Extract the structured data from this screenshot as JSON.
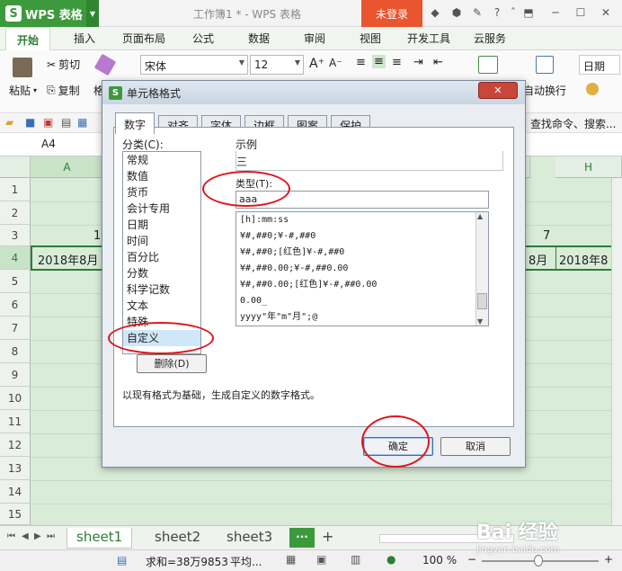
{
  "titlebar": {
    "app_name": "WPS 表格",
    "doc_title": "工作簿1 * - WPS 表格",
    "login": "未登录"
  },
  "ribbon_tabs": [
    "开始",
    "插入",
    "页面布局",
    "公式",
    "数据",
    "审阅",
    "视图",
    "开发工具",
    "云服务"
  ],
  "ribbon": {
    "cut": "剪切",
    "paste": "粘贴",
    "copy": "复制",
    "format": "格",
    "font_name": "宋体",
    "font_size": "12",
    "auto_wrap": "自动换行",
    "date_fmt": "日期",
    "find": "查找命令、搜索..."
  },
  "formula_bar": {
    "cell_ref": "A4"
  },
  "grid": {
    "columns": [
      "A",
      "H"
    ],
    "rows": [
      "1",
      "2",
      "3",
      "4",
      "5",
      "6",
      "7",
      "8",
      "9",
      "10",
      "11",
      "12",
      "13",
      "14",
      "15"
    ],
    "cells": {
      "a3": "1",
      "g3": "7",
      "a4": "2018年8月",
      "g4": "8月",
      "h4": "2018年8"
    }
  },
  "sheets": [
    "sheet1",
    "sheet2",
    "sheet3"
  ],
  "sheet_more": "···",
  "sheet_add": "+",
  "status": {
    "sum": "求和=38万9853",
    "avg": "平均...",
    "zoom": "100 %"
  },
  "dialog": {
    "title": "单元格格式",
    "close": "✕",
    "tabs": [
      "数字",
      "对齐",
      "字体",
      "边框",
      "图案",
      "保护"
    ],
    "category_label": "分类(C):",
    "categories": [
      "常规",
      "数值",
      "货币",
      "会计专用",
      "日期",
      "时间",
      "百分比",
      "分数",
      "科学记数",
      "文本",
      "特殊",
      "自定义"
    ],
    "sample_label": "示例",
    "sample_value": "三",
    "type_label": "类型(T):",
    "type_value": "aaa",
    "formats": [
      "[h]:mm:ss",
      "¥#,##0;¥-#,##0",
      "¥#,##0;[红色]¥-#,##0",
      "¥#,##0.00;¥-#,##0.00",
      "¥#,##0.00;[红色]¥-#,##0.00",
      "0.00_",
      "yyyy\"年\"m\"月\";@"
    ],
    "delete": "删除(D)",
    "description": "以现有格式为基础，生成自定义的数字格式。",
    "ok": "确定",
    "cancel": "取消"
  },
  "watermark": "Bai 经验",
  "watermark_url": "jingyan.baidu.com"
}
